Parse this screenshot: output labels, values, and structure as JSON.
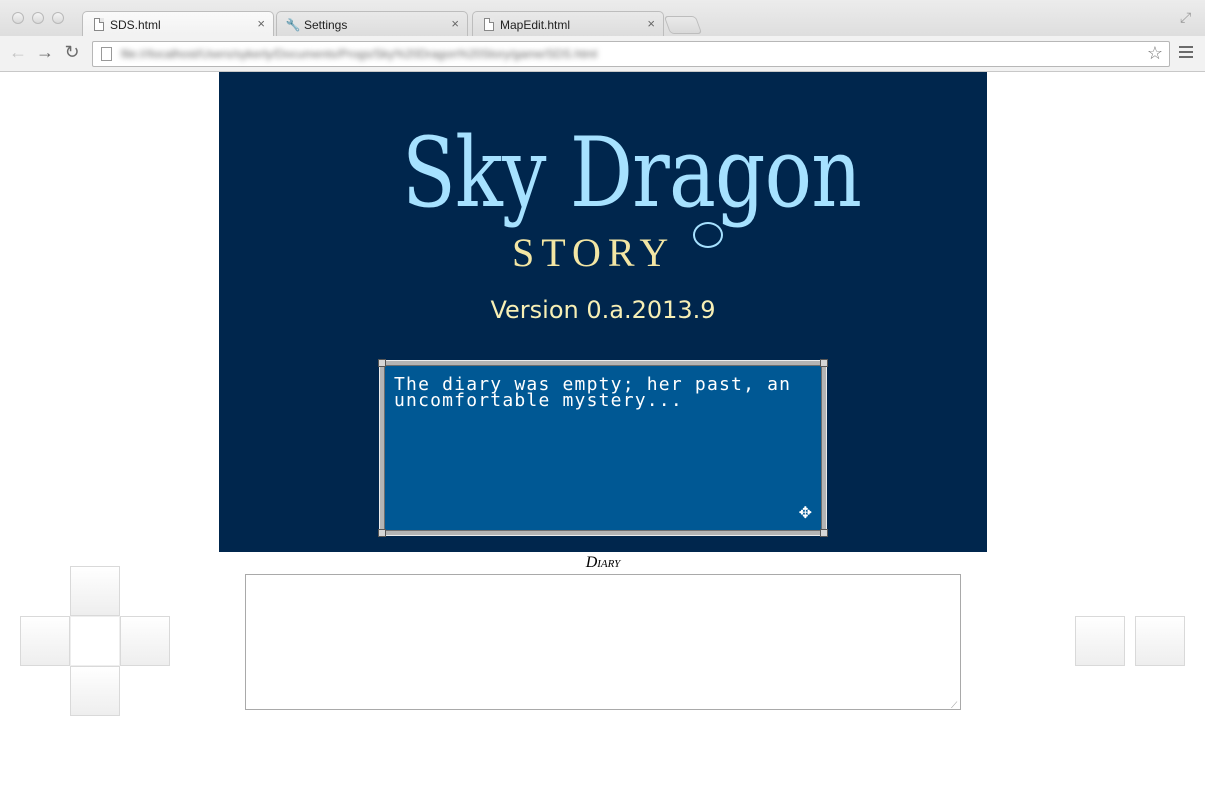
{
  "browser": {
    "tabs": [
      {
        "label": "SDS.html",
        "icon": "page-icon"
      },
      {
        "label": "Settings",
        "icon": "wrench-icon"
      },
      {
        "label": "MapEdit.html",
        "icon": "page-icon"
      }
    ],
    "tab_close_glyph": "×",
    "url": "file:///localhost/Users/sykerly/Documents/Progs/Sky%20Dragon%20Story/game/SDS.html"
  },
  "game": {
    "title_main": "Sky Dragon",
    "title_sub": "STORY",
    "version": "Version 0.a.2013.9",
    "dialog_text": "The diary was empty; her past, an uncomfortable mystery...",
    "advance_icon": "cursor-icon",
    "colors": {
      "background": "#00264d",
      "dialog": "#005894",
      "title": "#a6e1ff",
      "subtitle": "#f3e6a4"
    }
  },
  "diary": {
    "label": "Diary",
    "value": ""
  },
  "controls": {
    "dpad": [
      "up",
      "left",
      "center",
      "right",
      "down"
    ],
    "action_buttons": [
      "a",
      "b"
    ]
  }
}
